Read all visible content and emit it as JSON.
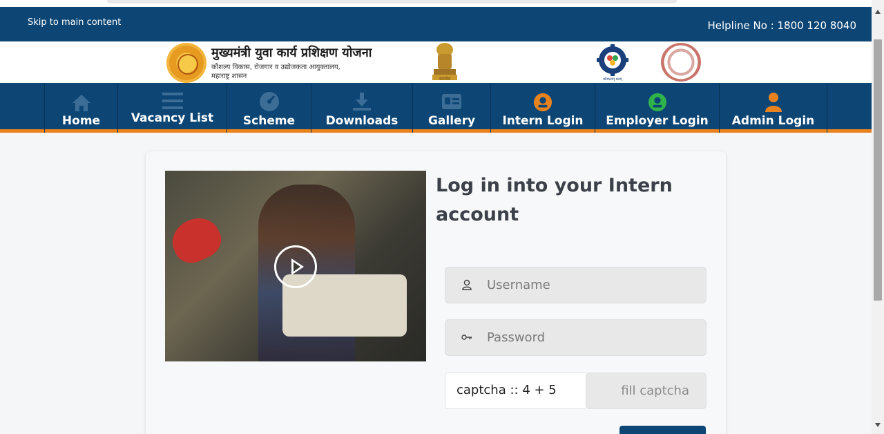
{
  "topbar": {
    "skip_link": "Skip to main content",
    "helpline": "Helpline No : 1800 120 8040"
  },
  "brand": {
    "title": "मुख्यमंत्री युवा कार्य प्रशिक्षण योजना",
    "subtitle_line1": "कौशल्य विकास, रोजगार व उद्योजकता आयुक्तालय,",
    "subtitle_line2": "महाराष्ट्र शासन",
    "logo_caption": "कौशल्यम् बलम्"
  },
  "nav": {
    "items": [
      {
        "label": "Home",
        "icon": "home-icon"
      },
      {
        "label": "Vacancy List",
        "icon": "list-icon"
      },
      {
        "label": "Scheme",
        "icon": "gauge-icon"
      },
      {
        "label": "Downloads",
        "icon": "download-icon"
      },
      {
        "label": "Gallery",
        "icon": "id-card-icon"
      },
      {
        "label": "Intern Login",
        "icon": "intern-user-icon"
      },
      {
        "label": "Employer Login",
        "icon": "employer-user-icon"
      },
      {
        "label": "Admin Login",
        "icon": "admin-user-icon"
      }
    ]
  },
  "login": {
    "title": "Log in into your Intern account",
    "username_placeholder": "Username",
    "password_placeholder": "Password",
    "captcha_text": "captcha :: 4 + 5",
    "captcha_placeholder": "fill captcha"
  },
  "colors": {
    "primary": "#0d4675",
    "accent": "#e8821e",
    "intern_icon": "#e8821e",
    "employer_icon": "#2fb34a",
    "admin_icon": "#e8821e"
  }
}
